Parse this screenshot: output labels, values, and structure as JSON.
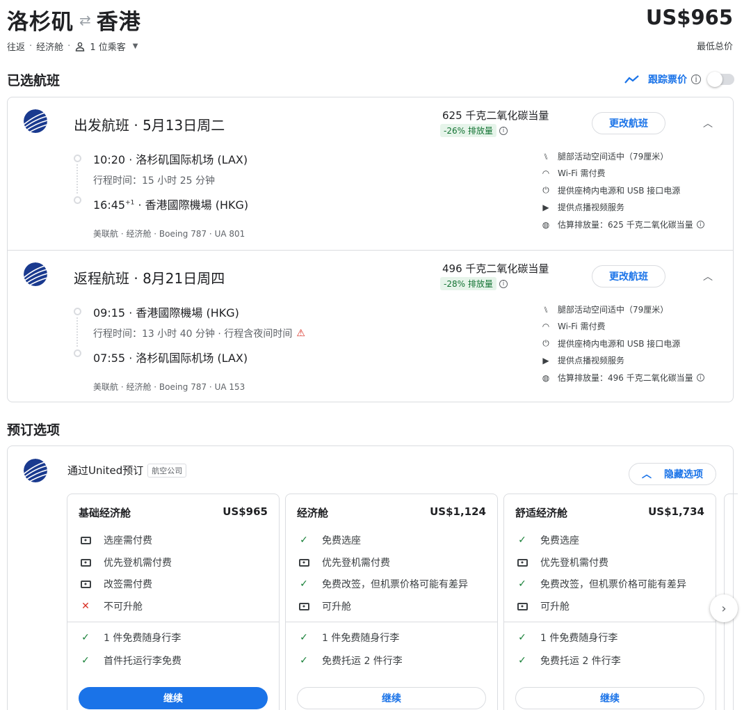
{
  "header": {
    "origin": "洛杉矶",
    "destination": "香港",
    "swap_icon": "⇄",
    "price": "US$965",
    "price_note": "最低总价",
    "trip_type": "往返",
    "cabin": "经济舱",
    "passengers": "1 位乘客"
  },
  "selected": {
    "title": "已选航班",
    "track_label": "跟踪票价",
    "track_enabled": false
  },
  "flights": [
    {
      "heading": "出发航班 · 5月13日周二",
      "co2": "625 千克二氧化碳当量",
      "co2_badge": "-26% 排放量",
      "change_label": "更改航班",
      "depart": "10:20 · 洛杉矶国际机场 (LAX)",
      "duration": "行程时间：15 小时 25 分钟",
      "arrive_time": "16:45",
      "arrive_sup": "+1",
      "arrive_airport": " · 香港國際機場 (HKG)",
      "airline_info": "美联航 · 经济舱 · Boeing 787 · UA 801",
      "amenities": [
        "腿部活动空间适中（79厘米）",
        "Wi-Fi 需付费",
        "提供座椅内电源和 USB 接口电源",
        "提供点播视频服务",
        "估算排放量：625 千克二氧化碳当量"
      ]
    },
    {
      "heading": "返程航班 · 8月21日周四",
      "co2": "496 千克二氧化碳当量",
      "co2_badge": "-28% 排放量",
      "change_label": "更改航班",
      "depart": "09:15 · 香港國際機場 (HKG)",
      "duration": "行程时间：13 小时 40 分钟 · 行程含夜间时间",
      "arrive": "07:55 · 洛杉矶国际机场 (LAX)",
      "airline_info": "美联航 · 经济舱 · Boeing 787 · UA 153",
      "amenities": [
        "腿部活动空间适中（79厘米）",
        "Wi-Fi 需付费",
        "提供座椅内电源和 USB 接口电源",
        "提供点播视频服务",
        "估算排放量：496 千克二氧化碳当量"
      ]
    }
  ],
  "booking": {
    "title": "预订选项",
    "via": "通过United预订",
    "tag": "航空公司",
    "hide_label": "隐藏选项",
    "fares": [
      {
        "name": "基础经济舱",
        "price": "US$965",
        "features": [
          "选座需付费",
          "优先登机需付费",
          "改签需付费",
          "不可升舱"
        ],
        "baggage": [
          "1 件免费随身行李",
          "首件托运行李免费"
        ],
        "cta": "继续"
      },
      {
        "name": "经济舱",
        "price": "US$1,124",
        "features": [
          "免费选座",
          "优先登机需付费",
          "免费改签，但机票价格可能有差异",
          "可升舱"
        ],
        "baggage": [
          "1 件免费随身行李",
          "免费托运 2 件行李"
        ],
        "cta": "继续"
      },
      {
        "name": "舒适经济舱",
        "price": "US$1,734",
        "features": [
          "免费选座",
          "优先登机需付费",
          "免费改签，但机票价格可能有差异",
          "可升舱"
        ],
        "baggage": [
          "1 件免费随身行李",
          "免费托运 2 件行李"
        ],
        "cta": "继续"
      }
    ]
  },
  "colors": {
    "accent": "#1a73e8",
    "green": "#188038",
    "red": "#d93025",
    "border": "#dadce0"
  }
}
